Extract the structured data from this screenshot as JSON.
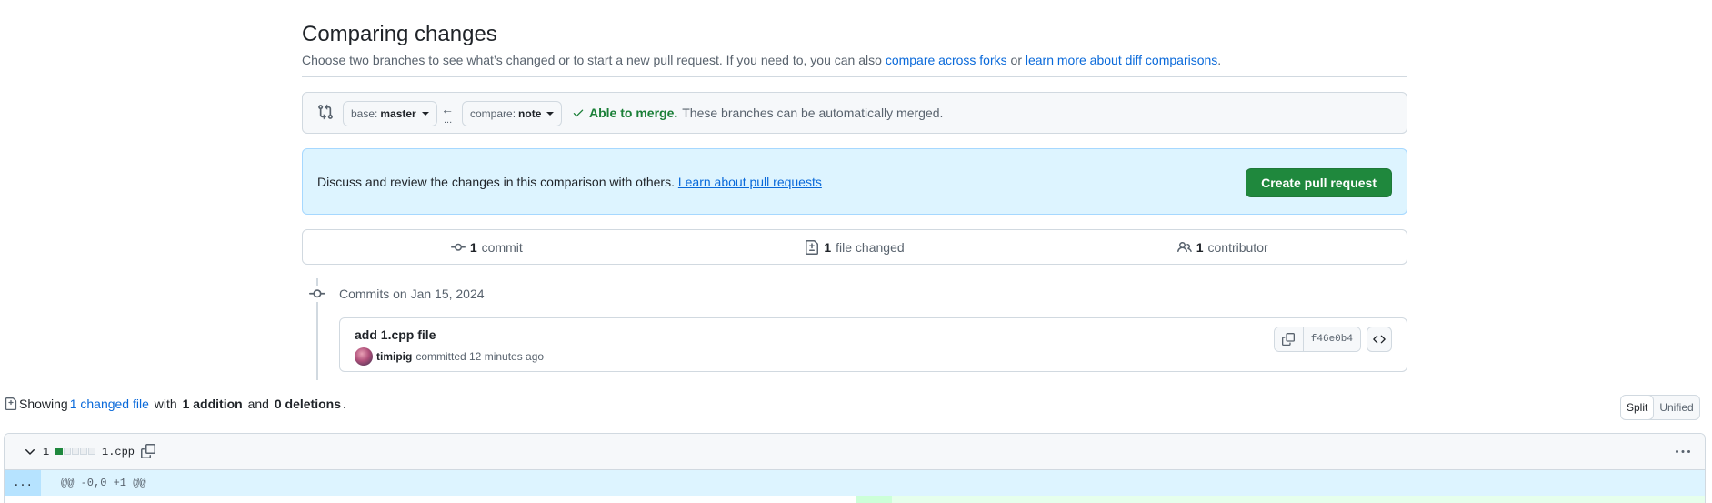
{
  "header": {
    "title": "Comparing changes",
    "description_prefix": "Choose two branches to see what’s changed or to start a new pull request. If you need to, you can also ",
    "compare_forks_link": "compare across forks",
    "description_or": " or ",
    "learn_diff_link": "learn more about diff comparisons",
    "description_suffix": "."
  },
  "range": {
    "base_prefix": "base:",
    "base_branch": "master",
    "compare_prefix": "compare:",
    "compare_branch": "note",
    "arrow": "←",
    "dots": "...",
    "merge_ok": "Able to merge.",
    "merge_text": "These branches can be automatically merged."
  },
  "blankslate": {
    "text": "Discuss and review the changes in this comparison with others. ",
    "link": "Learn about pull requests",
    "create_button": "Create pull request"
  },
  "summary": {
    "commits_count": "1",
    "commits_label": "commit",
    "files_count": "1",
    "files_label": "file changed",
    "contributors_count": "1",
    "contributors_label": "contributor"
  },
  "commits": {
    "date_heading": "Commits on Jan 15, 2024",
    "items": [
      {
        "title": "add 1.cpp file",
        "author": "timipig",
        "meta": "committed 12 minutes ago",
        "sha": "f46e0b4"
      }
    ]
  },
  "diff_summary": {
    "showing": "Showing ",
    "changed_files": "1 changed file",
    "with": " with ",
    "additions": "1 addition",
    "and": " and ",
    "deletions": "0 deletions",
    "period": "."
  },
  "view_toggle": {
    "split": "Split",
    "unified": "Unified",
    "selected": "Split"
  },
  "file": {
    "change_count": "1",
    "diffstat_additions": 1,
    "diffstat_blocks": 5,
    "filename": "1.cpp",
    "hunk_expand": "...",
    "hunk_header": "@@ -0,0 +1 @@"
  },
  "colors": {
    "primary_button": "#1f883d",
    "link": "#0969da",
    "success": "#1a7f37",
    "blankslate_bg": "#ddf4ff",
    "hunk_bg": "#ddf4ff",
    "addition_bg": "#e6ffec"
  }
}
